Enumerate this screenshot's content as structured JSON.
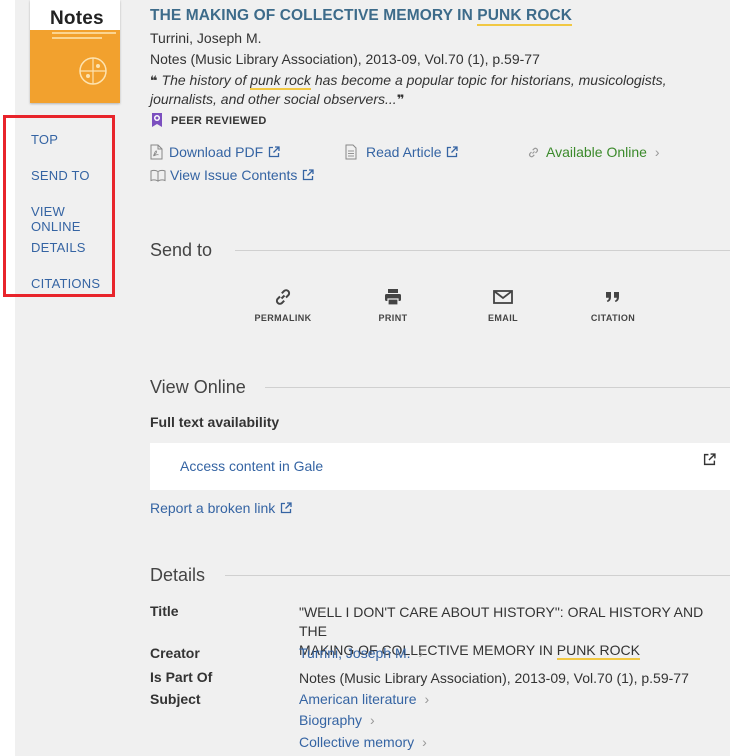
{
  "cover": {
    "title": "Notes"
  },
  "nav": {
    "items": [
      "TOP",
      "SEND TO",
      "VIEW ONLINE",
      "DETAILS",
      "CITATIONS"
    ]
  },
  "record": {
    "title_start": "THE MAKING OF COLLECTIVE MEMORY IN ",
    "title_highlight": "PUNK ROCK",
    "author": "Turrini, Joseph M.",
    "source": "Notes (Music Library Association), 2013-09, Vol.70 (1), p.59-77",
    "abstract_open_quote": "❝",
    "abstract_part1": " The history of ",
    "abstract_highlight": "punk rock",
    "abstract_part2": " has become a popular topic for historians, musicologists, journalists, and other social observers...",
    "abstract_close_quote": "❞",
    "peer_reviewed": "PEER REVIEWED"
  },
  "actions": {
    "download_pdf": "Download PDF",
    "read_article": "Read Article",
    "available_online": "Available Online",
    "view_issue": "View Issue Contents"
  },
  "send_to": {
    "heading": "Send to",
    "buttons": [
      "PERMALINK",
      "PRINT",
      "EMAIL",
      "CITATION"
    ]
  },
  "view_online": {
    "heading": "View Online",
    "full_text_label": "Full text availability",
    "access_link": "Access content in Gale",
    "report_link": "Report a broken link"
  },
  "details": {
    "heading": "Details",
    "title_label": "Title",
    "title_value_line1": "\"WELL I DON'T CARE ABOUT HISTORY\": ORAL HISTORY AND THE",
    "title_value_line2_start": "MAKING OF COLLECTIVE MEMORY IN ",
    "title_value_highlight": "PUNK ROCK",
    "creator_label": "Creator",
    "creator_value": "Turrini, Joseph M.",
    "ispartof_label": "Is Part Of",
    "ispartof_value": "Notes (Music Library Association), 2013-09, Vol.70 (1), p.59-77",
    "subject_label": "Subject",
    "subjects": [
      "American literature",
      "Biography",
      "Collective memory"
    ]
  },
  "colors": {
    "link": "#3564a3",
    "title": "#3d6b8a",
    "available": "#3b8a2b",
    "highlight": "#f1c843",
    "nav_border": "#e8242b",
    "peer_icon": "#7b4fbf"
  }
}
